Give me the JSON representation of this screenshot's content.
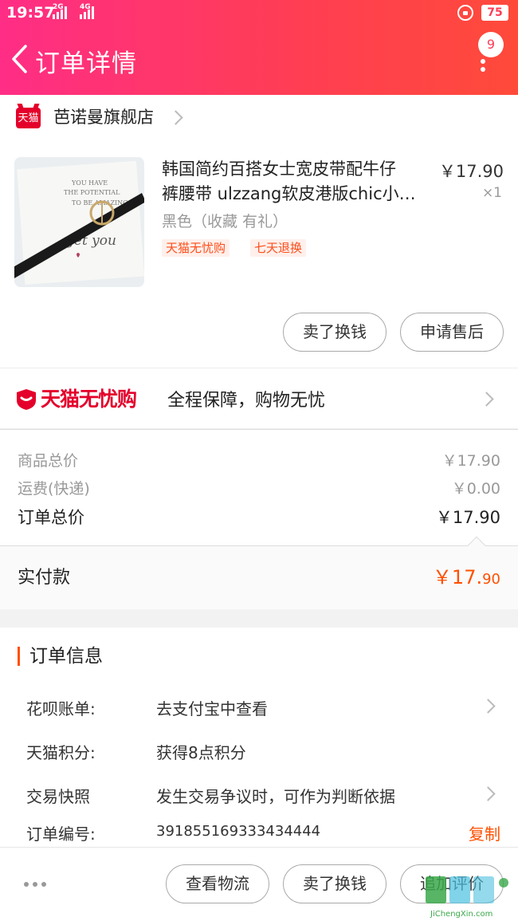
{
  "status_bar": {
    "time": "19:57",
    "sim1": "2G",
    "sim2": "4G",
    "battery": "75"
  },
  "header": {
    "title": "订单详情",
    "badge_count": "9"
  },
  "store": {
    "logo_text": "天猫",
    "name": "芭诺曼旗舰店"
  },
  "product": {
    "title_line1": "韩国简约百搭女士宽皮带配牛仔",
    "title_line2": "裤腰带 ulzzang软皮港版chic小…",
    "spec": "黑色（收藏 有礼）",
    "price": "￥17.90",
    "quantity": "×1",
    "tags": [
      "天猫无忧购",
      "七天退换"
    ],
    "image_text": [
      "YOU HAVE",
      "THE POTENTIAL",
      "TO BE AMAZING",
      "get you"
    ]
  },
  "product_actions": {
    "sell_label": "卖了换钱",
    "aftersale_label": "申请售后"
  },
  "guarantee": {
    "brand": "天猫无忧购",
    "text": "全程保障，购物无忧"
  },
  "summary": {
    "goods_label": "商品总价",
    "goods_value": "￥17.90",
    "shipping_label": "运费(快递)",
    "shipping_value": "￥0.00",
    "total_label": "订单总价",
    "total_value": "￥17.90",
    "paid_label": "实付款",
    "paid_value_main": "￥17.",
    "paid_value_cents": "90"
  },
  "order_info": {
    "title": "订单信息",
    "rows": [
      {
        "label": "花呗账单:",
        "value": "去支付宝中查看"
      },
      {
        "label": "天猫积分:",
        "value": "获得8点积分"
      },
      {
        "label": "交易快照",
        "value": "发生交易争议时，可作为判断依据"
      },
      {
        "label": "订单编号:",
        "value": "391855169333434444"
      }
    ],
    "copy_label": "复制"
  },
  "bottom_bar": {
    "logistics_label": "查看物流",
    "sell_label": "卖了换钱",
    "review_label": "追加评价"
  },
  "watermark": {
    "text": "JiChengXin.com"
  },
  "colors": {
    "header_start": "#ff2d86",
    "header_end": "#ff4a3a",
    "tmall_red": "#e4002b",
    "accent_orange": "#ff5000"
  }
}
